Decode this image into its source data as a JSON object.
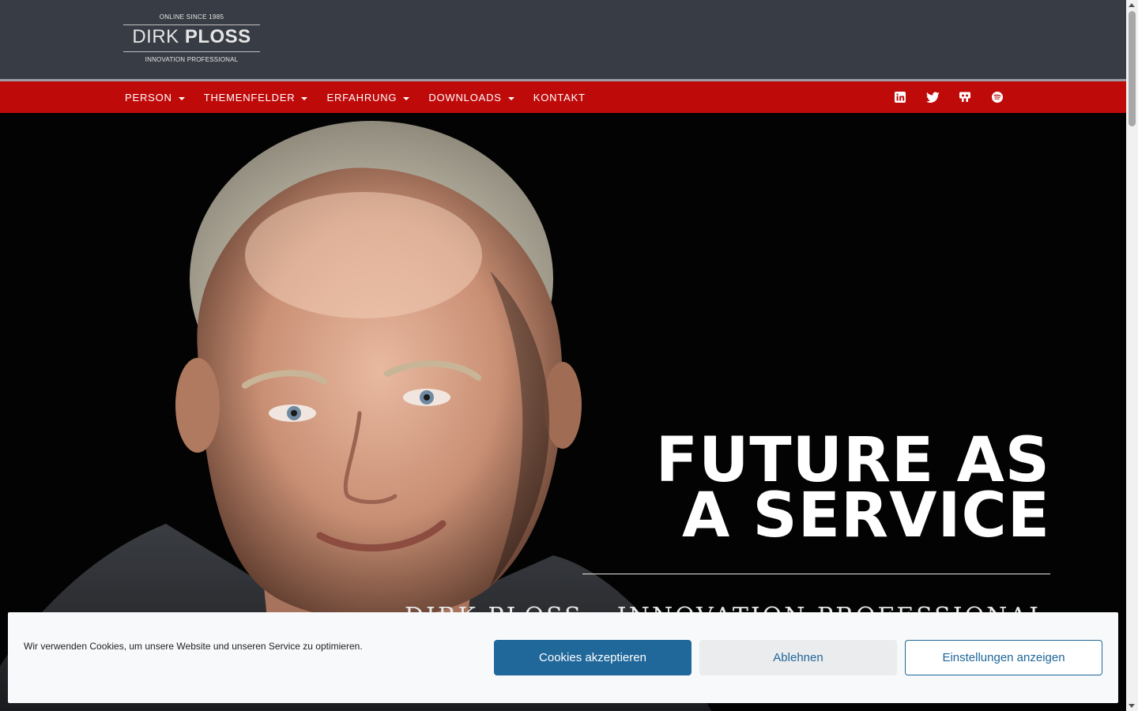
{
  "logo": {
    "since": "ONLINE SINCE 1985",
    "name_first": "DIRK ",
    "name_last": "PLOSS",
    "tagline": "INNOVATION PROFESSIONAL"
  },
  "nav": {
    "items": [
      {
        "label": "PERSON",
        "has_dropdown": true
      },
      {
        "label": "THEMENFELDER",
        "has_dropdown": true
      },
      {
        "label": "ERFAHRUNG",
        "has_dropdown": true
      },
      {
        "label": "DOWNLOADS",
        "has_dropdown": true
      },
      {
        "label": "KONTAKT",
        "has_dropdown": false
      }
    ],
    "social_icons": [
      "linkedin-icon",
      "twitter-icon",
      "slideshare-icon",
      "spotify-icon"
    ]
  },
  "hero": {
    "headline_line1": "FUTURE AS",
    "headline_line2": "A SERVICE",
    "subheadline": "DIRK PLOSS – INNOVATION PROFESSIONAL"
  },
  "cookie_banner": {
    "message": "Wir verwenden Cookies, um unsere Website und unseren Service zu optimieren.",
    "accept_label": "Cookies akzeptieren",
    "deny_label": "Ablehnen",
    "settings_label": "Einstellungen anzeigen"
  },
  "colors": {
    "header_bg": "#383c44",
    "nav_bg": "#bf0a0a",
    "accent_blue": "#20679a",
    "hero_bg": "#030303"
  }
}
